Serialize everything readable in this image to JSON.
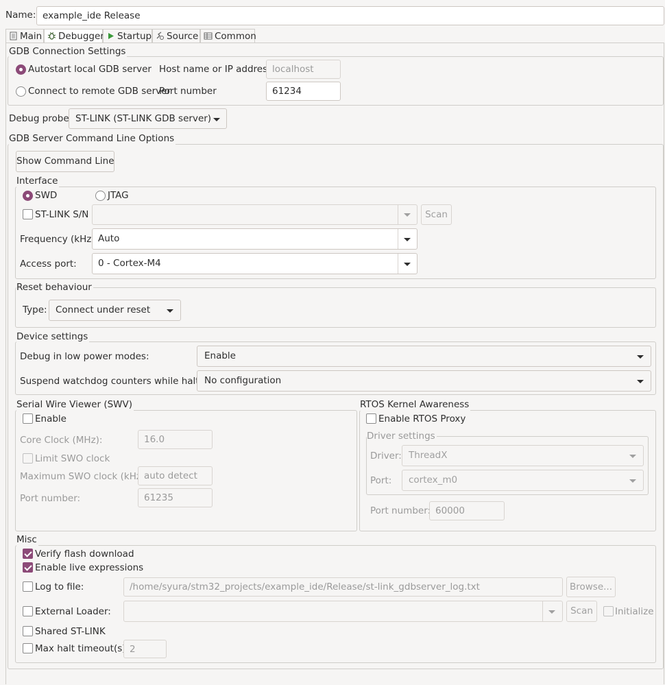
{
  "config": {
    "name_label": "Name:",
    "name_value": "example_ide Release"
  },
  "tabs": [
    {
      "label": "Main",
      "icon": "main-tab-icon"
    },
    {
      "label": "Debugger",
      "icon": "debugger-tab-icon"
    },
    {
      "label": "Startup",
      "icon": "startup-tab-icon"
    },
    {
      "label": "Source",
      "icon": "source-tab-icon"
    },
    {
      "label": "Common",
      "icon": "common-tab-icon"
    }
  ],
  "gdb_connection": {
    "title": "GDB Connection Settings",
    "autostart_label": "Autostart local GDB server",
    "remote_label": "Connect to remote GDB server",
    "host_label": "Host name or IP address",
    "host_value": "localhost",
    "port_label": "Port number",
    "port_value": "61234"
  },
  "debug_probe": {
    "label": "Debug probe",
    "value": "ST-LINK (ST-LINK GDB server)"
  },
  "gdb_server_options": {
    "title": "GDB Server Command Line Options",
    "show_cmd_button": "Show Command Line",
    "interface": {
      "title": "Interface",
      "swd_label": "SWD",
      "jtag_label": "JTAG",
      "stlink_sn_label": "ST-LINK S/N",
      "stlink_sn_value": "",
      "scan_button": "Scan",
      "frequency_label": "Frequency (kHz):",
      "frequency_value": "Auto",
      "access_port_label": "Access port:",
      "access_port_value": "0 - Cortex-M4"
    },
    "reset": {
      "title": "Reset behaviour",
      "type_label": "Type:",
      "type_value": "Connect under reset"
    },
    "device": {
      "title": "Device settings",
      "low_power_label": "Debug in low power modes:",
      "low_power_value": "Enable",
      "watchdog_label": "Suspend watchdog counters while halted:",
      "watchdog_value": "No configuration"
    },
    "swv": {
      "title": "Serial Wire Viewer (SWV)",
      "enable_label": "Enable",
      "core_clock_label": "Core Clock (MHz):",
      "core_clock_value": "16.0",
      "limit_swo_label": "Limit SWO clock",
      "max_swo_label": "Maximum SWO clock (kHz):",
      "max_swo_value": "auto detect",
      "port_label": "Port number:",
      "port_value": "61235"
    },
    "rtos": {
      "title": "RTOS Kernel Awareness",
      "enable_label": "Enable RTOS Proxy",
      "driver_settings_title": "Driver settings",
      "driver_label": "Driver:",
      "driver_value": "ThreadX",
      "port_label": "Port:",
      "port_value": "cortex_m0",
      "port_number_label": "Port number:",
      "port_number_value": "60000"
    },
    "misc": {
      "title": "Misc",
      "verify_flash_label": "Verify flash download",
      "live_expr_label": "Enable live expressions",
      "log_file_label": "Log to file:",
      "log_file_value": "/home/syura/stm32_projects/example_ide/Release/st-link_gdbserver_log.txt",
      "browse_button": "Browse...",
      "ext_loader_label": "External Loader:",
      "ext_loader_value": "",
      "scan_button": "Scan",
      "initialize_label": "Initialize",
      "shared_stlink_label": "Shared ST-LINK",
      "max_halt_label": "Max halt timeout(s):",
      "max_halt_value": "2"
    }
  },
  "colors": {
    "accent": "#8c4a78",
    "background": "#f6f5f4",
    "border": "#cfcdc9",
    "disabled_text": "#9a9a9a"
  }
}
